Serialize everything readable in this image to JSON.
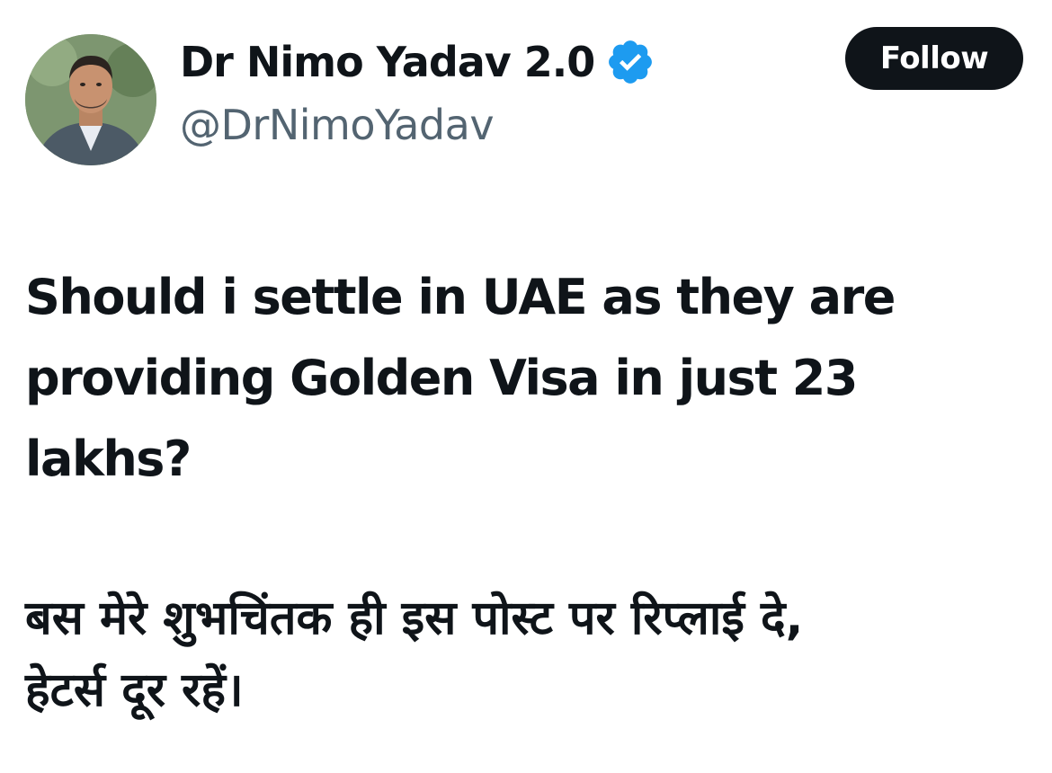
{
  "author": {
    "display_name": "Dr Nimo Yadav 2.0",
    "handle": "@DrNimoYadav",
    "verified": true,
    "verified_badge_icon": "verified-badge-icon",
    "avatar_icon": "profile-photo"
  },
  "actions": {
    "follow_label": "Follow"
  },
  "tweet": {
    "text_english": "Should i settle in UAE as they are\nproviding Golden Visa in just 23\nlakhs?",
    "text_hindi": "बस मेरे शुभचिंतक ही इस पोस्ट पर रिप्लाई दे,\nहेटर्स दूर रहें।"
  },
  "colors": {
    "text_primary": "#0f1419",
    "text_secondary": "#536471",
    "follow_button_bg": "#0f1419",
    "follow_button_text": "#ffffff",
    "verified_blue": "#1d9bf0"
  }
}
